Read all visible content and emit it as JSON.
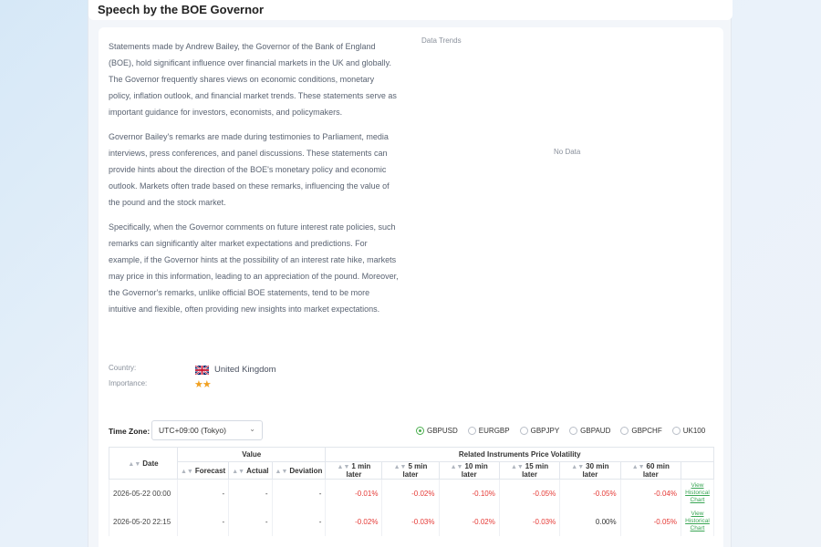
{
  "page": {
    "title": "Speech by the BOE Governor"
  },
  "description": {
    "paragraphs": [
      "Statements made by Andrew Bailey, the Governor of the Bank of England (BOE), hold significant influence over financial markets in the UK and globally. The Governor frequently shares views on economic conditions, monetary policy, inflation outlook, and financial market trends. These statements serve as important guidance for investors, economists, and policymakers.",
      "Governor Bailey's remarks are made during testimonies to Parliament, media interviews, press conferences, and panel discussions. These statements can provide hints about the direction of the BOE's monetary policy and economic outlook. Markets often trade based on these remarks, influencing the value of the pound and the stock market.",
      "Specifically, when the Governor comments on future interest rate policies, such remarks can significantly alter market expectations and predictions. For example, if the Governor hints at the possibility of an interest rate hike, markets may price in this information, leading to an appreciation of the pound. Moreover, the Governor's remarks, unlike official BOE statements, tend to be more intuitive and flexible, often providing new insights into market expectations."
    ]
  },
  "trends": {
    "label": "Data Trends",
    "empty_text": "No Data"
  },
  "meta": {
    "country_label": "Country:",
    "country_value": "United Kingdom",
    "country_flag": "uk-flag-icon",
    "importance_label": "Importance:",
    "importance_stars": "★★",
    "importance_level": 2,
    "star_color": "#f0a020"
  },
  "timezone": {
    "label": "Time Zone:",
    "value": "UTC+09:00 (Tokyo)"
  },
  "instruments": {
    "selected": "GBPUSD",
    "items": [
      "GBPUSD",
      "EURGBP",
      "GBPJPY",
      "GBPAUD",
      "GBPCHF",
      "UK100"
    ]
  },
  "table": {
    "group_value": "Value",
    "group_volatility": "Related Instruments Price Volatility",
    "date_header": "Date",
    "value_headers": [
      "Forecast",
      "Actual",
      "Deviation"
    ],
    "volatility_headers": [
      "1 min later",
      "5 min later",
      "10 min later",
      "15 min later",
      "30 min later",
      "60 min later"
    ],
    "link_lines": [
      "View",
      "Historical",
      "Chart"
    ],
    "rows": [
      {
        "date": "2026-05-22 00:00",
        "forecast": "-",
        "actual": "-",
        "deviation": "-",
        "vol": [
          "-0.01%",
          "-0.02%",
          "-0.10%",
          "-0.05%",
          "-0.05%",
          "-0.04%"
        ]
      },
      {
        "date": "2026-05-20 22:15",
        "forecast": "-",
        "actual": "-",
        "deviation": "-",
        "vol": [
          "-0.02%",
          "-0.03%",
          "-0.02%",
          "-0.03%",
          "0.00%",
          "-0.05%"
        ]
      }
    ]
  },
  "colors": {
    "negative": "#e53935",
    "accent": "#4caf50",
    "link": "#3aa655"
  }
}
